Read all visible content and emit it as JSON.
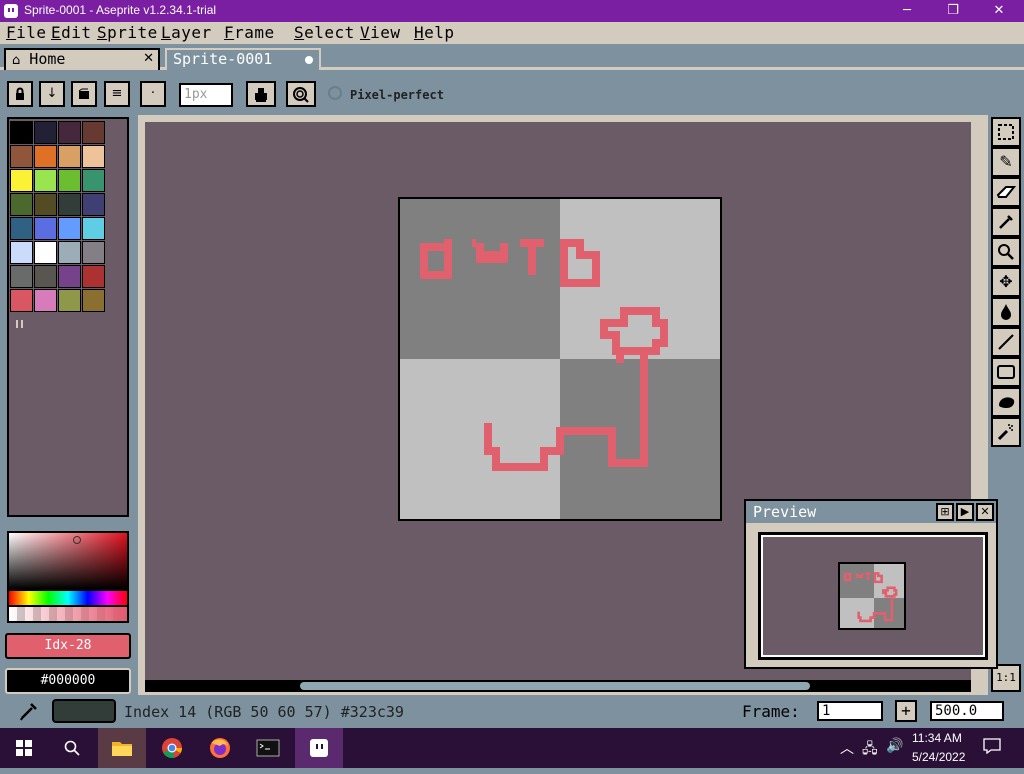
{
  "window": {
    "title": "Sprite-0001 - Aseprite v1.2.34.1-trial",
    "minimize": "─",
    "maximize": "❐",
    "close": "✕"
  },
  "menu": [
    "File",
    "Edit",
    "Sprite",
    "Layer",
    "Frame",
    "Select",
    "View",
    "Help"
  ],
  "tabs": [
    {
      "label": "Home",
      "icon": "home-icon",
      "close": "✕"
    },
    {
      "label": "Sprite-0001",
      "active": true
    }
  ],
  "context_bar": {
    "brush_size_placeholder": "1px",
    "pixel_perfect_label": "Pixel-perfect"
  },
  "palette": [
    "#000000",
    "#222034",
    "#45283c",
    "#663931",
    "#8f563b",
    "#df7126",
    "#d9a066",
    "#eec39a",
    "#fbf236",
    "#99e550",
    "#6abe30",
    "#37946e",
    "#4b692f",
    "#524b24",
    "#323c39",
    "#3f3f74",
    "#306082",
    "#5b6ee1",
    "#639bff",
    "#5fcde4",
    "#cbdbfc",
    "#ffffff",
    "#9badb7",
    "#847e87",
    "#696a6a",
    "#595652",
    "#76428a",
    "#ac3232",
    "#d95763",
    "#d77bba",
    "#8f974a",
    "#8a6f30"
  ],
  "colors": {
    "foreground_label": "Idx-28",
    "foreground": "#e1606e",
    "background_label": "#000000",
    "background": "#000000",
    "stroke": "#e1606e"
  },
  "preview": {
    "title": "Preview"
  },
  "zoom_fit_label": "1:1",
  "status": {
    "text": "Index 14 (RGB 50 60 57) #323c39",
    "color": "#323c39",
    "frame_label": "Frame:",
    "frame_value": "1",
    "frame_plus": "+",
    "zoom_value": "500.0"
  },
  "taskbar": {
    "time": "11:34 AM",
    "date": "5/24/2022"
  }
}
